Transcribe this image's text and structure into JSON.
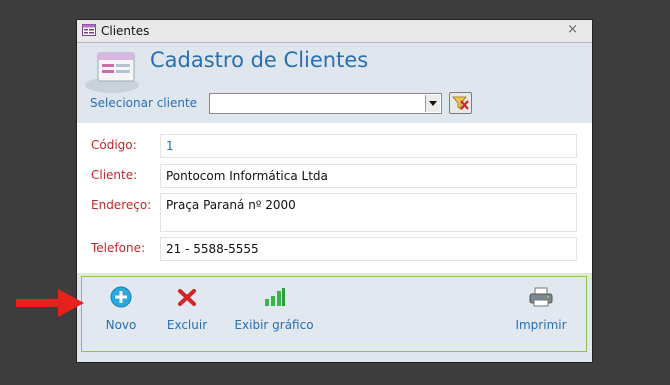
{
  "window": {
    "title": "Clientes",
    "close_symbol": "×"
  },
  "form": {
    "title": "Cadastro de Clientes",
    "select_label": "Selecionar cliente",
    "select_value": ""
  },
  "fields": {
    "codigo": {
      "label": "Código:",
      "value": "1"
    },
    "cliente": {
      "label": "Cliente:",
      "value": "Pontocom Informática Ltda"
    },
    "endereco": {
      "label": "Endereço:",
      "value": "Praça Paraná nº 2000"
    },
    "telefone": {
      "label": "Telefone:",
      "value": "21 - 5588-5555"
    }
  },
  "footer": {
    "novo": "Novo",
    "excluir": "Excluir",
    "grafico": "Exibir gráfico",
    "imprimir": "Imprimir"
  },
  "colors": {
    "accent": "#2a6fb0",
    "field_label": "#c0262b",
    "footer_border": "#8fbf55",
    "arrow": "#e8211c"
  },
  "icons": {
    "window": "form-window-icon",
    "header": "form-header-icon",
    "combo": "chevron-down-icon",
    "filter": "clear-filter-icon",
    "novo": "plus-circle-icon",
    "excluir": "delete-x-icon",
    "grafico": "bar-chart-icon",
    "imprimir": "printer-icon",
    "pointer": "red-arrow-icon"
  }
}
